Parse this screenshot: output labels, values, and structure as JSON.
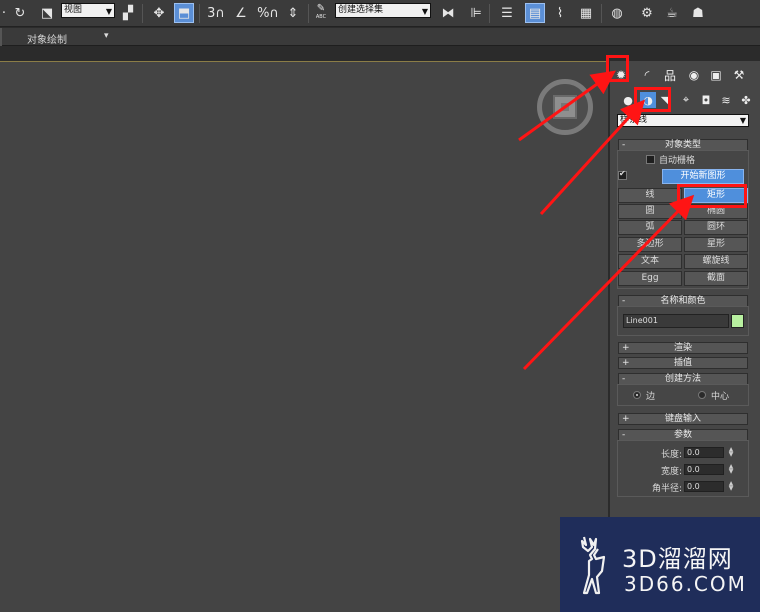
{
  "toolbar": {
    "view_combo": "视图",
    "digit_3": "3",
    "percent": "%",
    "abc": "ABC",
    "selection_set_combo": "创建选择集"
  },
  "secondbar": {
    "label": "对象绘制",
    "dropdown_glyph": "▾"
  },
  "panel": {
    "category_combo": "样条线",
    "rollouts": {
      "object_type": "对象类型",
      "name_color": "名称和颜色",
      "rendering": "渲染",
      "interpolation": "插值",
      "creation_method": "创建方法",
      "keyboard_entry": "键盘输入",
      "parameters": "参数"
    },
    "autogrid_label": "自动栅格",
    "start_new_shape": "开始新图形",
    "shape_buttons": [
      "线",
      "矩形",
      "圆",
      "椭圆",
      "弧",
      "圆环",
      "多边形",
      "星形",
      "文本",
      "螺旋线",
      "Egg",
      "截面"
    ],
    "name_field_value": "Line001",
    "swatch_color": "#b8f0a0",
    "radio_edge": "边",
    "radio_center": "中心",
    "param_labels": [
      "长度:",
      "宽度:",
      "角半径:"
    ],
    "param_values": [
      "0.0",
      "0.0",
      "0.0"
    ]
  },
  "watermark": {
    "line1": "3D溜溜网",
    "line2": "3D66.COM"
  },
  "colors": {
    "highlight": "#ff1414",
    "selected_button": "#4f8fdc",
    "viewport": "#444444"
  }
}
